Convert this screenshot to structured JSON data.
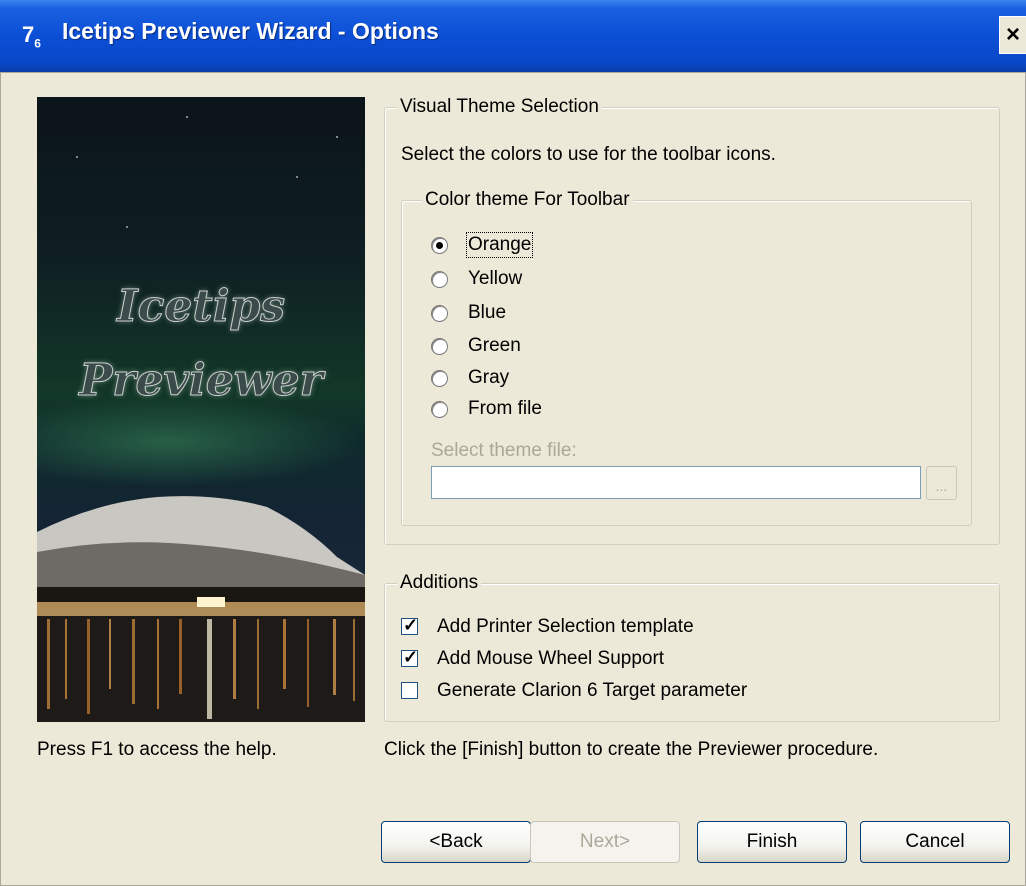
{
  "window": {
    "title": "Icetips Previewer Wizard - Options",
    "icon": "clarion-icon",
    "close_label": "×"
  },
  "banner": {
    "line1": "Icetips",
    "line2": "Previewer"
  },
  "help_text": "Press F1 to access the help.",
  "finish_hint": "Click the [Finish] button to create the Previewer procedure.",
  "visual_theme": {
    "legend": "Visual Theme Selection",
    "instruction": "Select the colors to use for the toolbar icons.",
    "color_theme": {
      "legend": "Color theme For Toolbar",
      "selected": "Orange",
      "options": [
        "Orange",
        "Yellow",
        "Blue",
        "Green",
        "Gray",
        "From file"
      ]
    },
    "theme_file": {
      "label": "Select theme file:",
      "value": "",
      "browse_label": "..."
    }
  },
  "additions": {
    "legend": "Additions",
    "items": [
      {
        "label": "Add Printer Selection template",
        "checked": true
      },
      {
        "label": "Add Mouse Wheel Support",
        "checked": true
      },
      {
        "label": "Generate Clarion 6 Target parameter",
        "checked": false
      }
    ]
  },
  "buttons": {
    "back": "<Back",
    "next": "Next>",
    "finish": "Finish",
    "cancel": "Cancel"
  },
  "colors": {
    "titlebar": "#0b4fd6",
    "dialog_bg": "#ece9d8",
    "disabled_text": "#aca899"
  }
}
